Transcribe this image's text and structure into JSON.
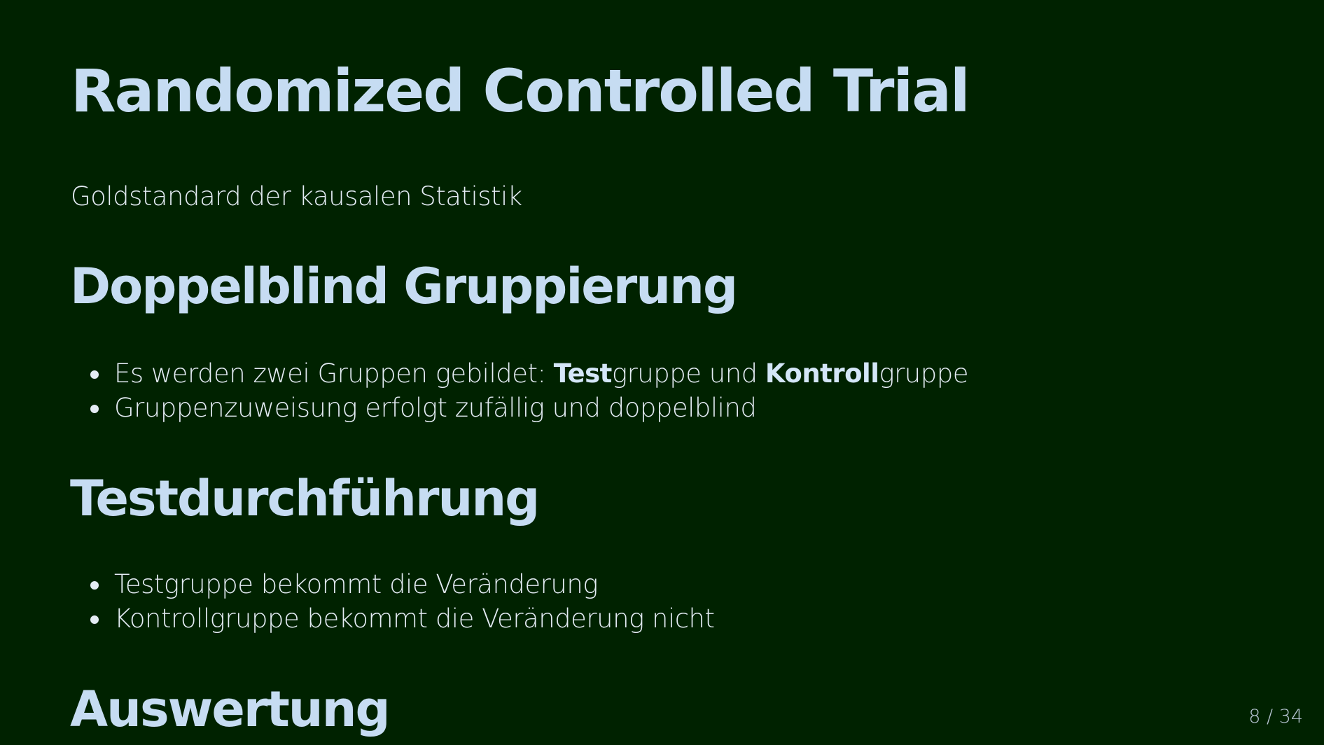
{
  "slide": {
    "title": "Randomized Controlled Trial",
    "subtitle": "Goldstandard der kausalen Statistik",
    "sections": [
      {
        "heading": "Doppelblind Gruppierung",
        "bullets": [
          {
            "part1": "Es werden zwei Gruppen gebildet: ",
            "bold1": "Test",
            "part2": "gruppe und ",
            "bold2": "Kontroll",
            "part3": "gruppe"
          },
          {
            "text": "Gruppenzuweisung erfolgt zufällig und doppelblind"
          }
        ]
      },
      {
        "heading": "Testdurchführung",
        "bullets": [
          {
            "text": "Testgruppe bekommt die Veränderung"
          },
          {
            "text": "Kontrollgruppe bekommt die Veränderung nicht"
          }
        ]
      },
      {
        "heading": "Auswertung"
      }
    ],
    "page_number": "8 / 34"
  },
  "colors": {
    "background": "#002200",
    "heading": "#c6dcf2",
    "body_text": "#e4ecf4"
  }
}
